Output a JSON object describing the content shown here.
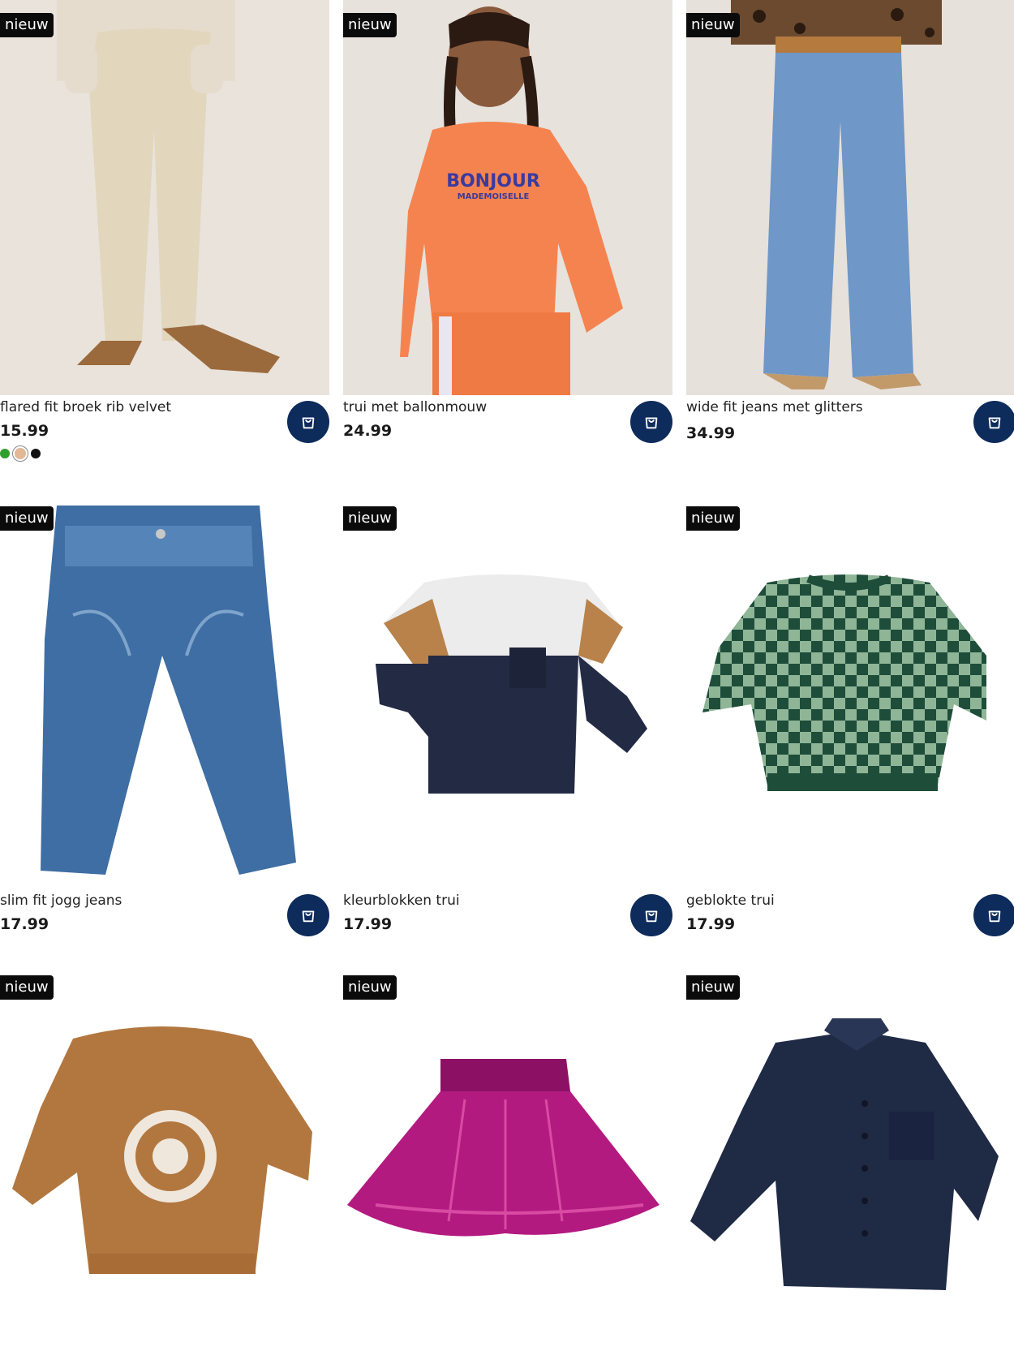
{
  "badge_text": "nieuw",
  "products": [
    {
      "name": "flared fit broek rib velvet",
      "price": "15.99",
      "swatches": [
        "#2f9e2f",
        "#e3b896",
        "#111111"
      ],
      "image": "flared-velvet-pants"
    },
    {
      "name": "trui met ballonmouw",
      "price": "24.99",
      "image": "orange-bonjour-sweater",
      "print_line1": "BONJOUR",
      "print_line2": "MADEMOISELLE"
    },
    {
      "name": "wide fit jeans met glitters",
      "price": "34.99",
      "image": "wide-fit-glitter-jeans"
    },
    {
      "name": "slim fit jogg jeans",
      "price": "17.99",
      "image": "slim-jogg-jeans"
    },
    {
      "name": "kleurblokken trui",
      "price": "17.99",
      "image": "colorblock-sweater"
    },
    {
      "name": "geblokte trui",
      "price": "17.99",
      "image": "checkered-sweater"
    },
    {
      "name": "",
      "price": "",
      "image": "explorer-sweater"
    },
    {
      "name": "",
      "price": "",
      "image": "pink-pleated-skirt"
    },
    {
      "name": "",
      "price": "",
      "image": "navy-shirt"
    }
  ],
  "colors": {
    "cart_button": "#0d2b5b",
    "badge": "#0b0b0b"
  },
  "icons": {
    "cart": "shopping-bag-icon"
  }
}
